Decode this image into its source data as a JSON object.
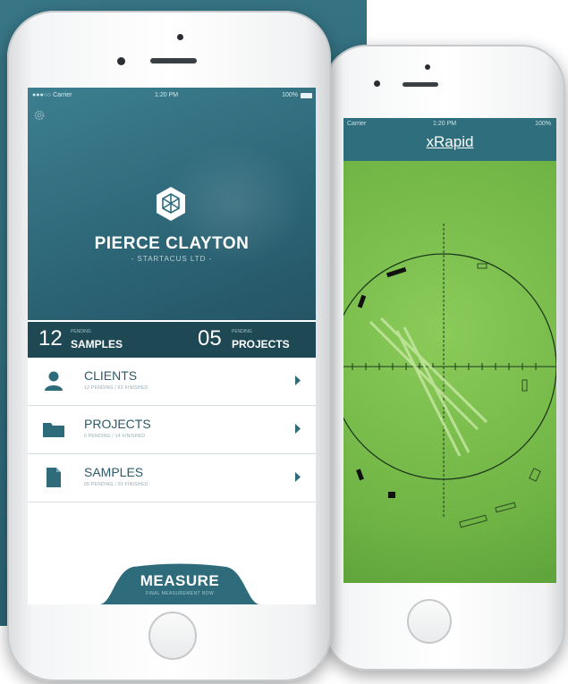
{
  "colors": {
    "brand": "#2d6f80",
    "dark_band": "#1f4855",
    "screen_green": "#7ec24f",
    "row_text": "#2c5a68"
  },
  "phone_main": {
    "status": {
      "carrier": "●●●○○ Carrier",
      "time": "1:20 PM",
      "battery": "100%"
    },
    "icons": {
      "settings": "gear-icon",
      "logo": "hexagon-cube-logo"
    },
    "profile": {
      "name": "PIERCE CLAYTON",
      "company": "- STARTACUS LTD -"
    },
    "stats": [
      {
        "value": "12",
        "pending": "PENDING",
        "label": "SAMPLES"
      },
      {
        "value": "05",
        "pending": "PENDING",
        "label": "PROJECTS"
      }
    ],
    "menu": [
      {
        "label": "CLIENTS",
        "sub": "12 PENDING / 62 FINISHED",
        "icon": "person-icon"
      },
      {
        "label": "PROJECTS",
        "sub": "0 PENDING / 14 FINISHED",
        "icon": "folder-icon"
      },
      {
        "label": "SAMPLES",
        "sub": "05 PENDING / 93 FINISHED",
        "icon": "document-icon"
      }
    ],
    "measure": {
      "label": "MEASURE",
      "sub": "FINAL MEASUREMENT NOW"
    }
  },
  "phone_secondary": {
    "status": {
      "carrier": "Carrier",
      "time": "1:20 PM",
      "battery": "100%"
    },
    "title": "xRapid"
  }
}
